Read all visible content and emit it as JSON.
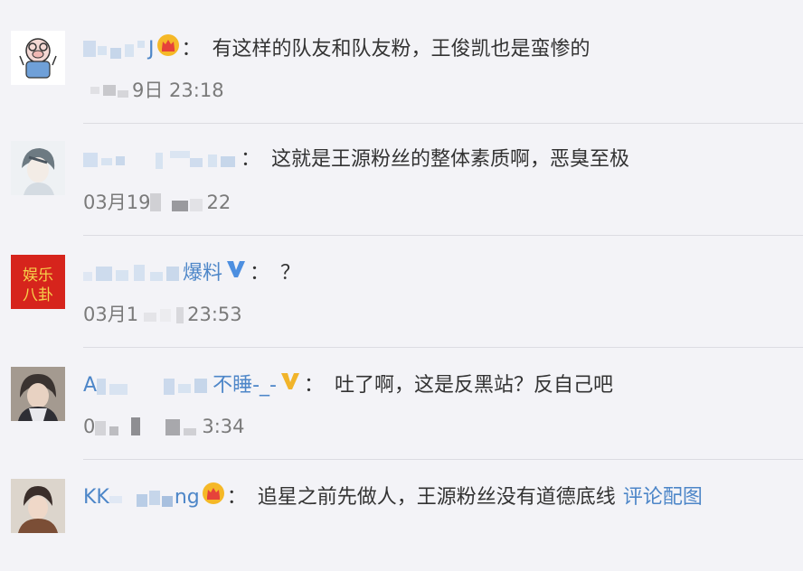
{
  "comments": [
    {
      "name_suffix": "J",
      "badge": "crown-icon",
      "text": "有这样的队友和队友粉，王俊凯也是蛮惨的",
      "time": "9日 23:18"
    },
    {
      "name_suffix": "",
      "badge": "",
      "text": "这就是王源粉丝的整体素质啊，恶臭至极",
      "time_prefix": "03月19",
      "time_suffix": "22"
    },
    {
      "name_suffix": "爆料",
      "badge": "verified-v-icon",
      "text": "？",
      "time_prefix": "03月1",
      "time_suffix": "23:53",
      "avatar_text": "娱乐\n八卦"
    },
    {
      "name_prefix": "A",
      "name_suffix": "不睡-_-",
      "badge": "gold-v-icon",
      "text": "吐了啊，这是反黑站？反自己吧",
      "time_prefix": "0",
      "time_suffix": "3:34"
    },
    {
      "name_prefix": "KK",
      "name_suffix": "ng",
      "badge": "crown-icon",
      "text": "追星之前先做人，王源粉丝没有道德底线",
      "link": "评论配图"
    }
  ],
  "colon": "："
}
